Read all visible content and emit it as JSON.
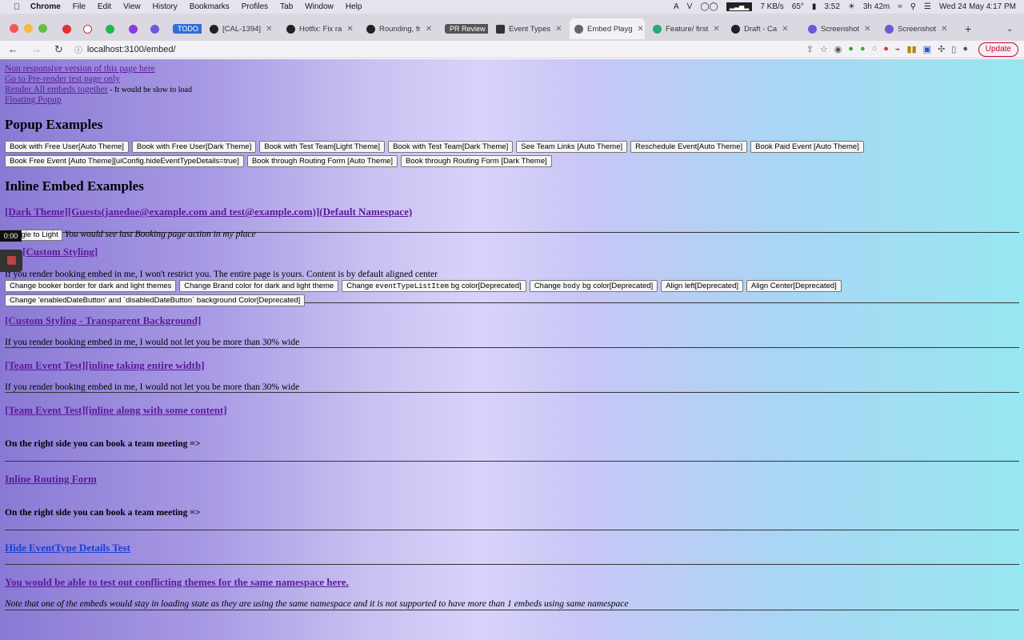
{
  "menubar": {
    "app": "Chrome",
    "menus": [
      "File",
      "Edit",
      "View",
      "History",
      "Bookmarks",
      "Profiles",
      "Tab",
      "Window",
      "Help"
    ],
    "net": "7 KB/s",
    "temp": "65°",
    "time_short": "3:52",
    "battery_time": "3h 42m",
    "datetime": "Wed 24 May  4:17 PM"
  },
  "tabs": [
    {
      "label": "TODO",
      "kind": "pill"
    },
    {
      "label": "[CAL-1394]"
    },
    {
      "label": "Hotfix: Fix ra"
    },
    {
      "label": "Rounding, fr"
    },
    {
      "label": "PR Review",
      "kind": "pill-dark"
    },
    {
      "label": "Event Types"
    },
    {
      "label": "Embed Playg",
      "active": true
    },
    {
      "label": "Feature/ first"
    },
    {
      "label": "Draft - Ca"
    },
    {
      "label": "Screenshot"
    },
    {
      "label": "Screenshot"
    }
  ],
  "address": {
    "url": "localhost:3100/embed/",
    "update_label": "Update"
  },
  "links": {
    "non_responsive": "Non responsive version of this page here",
    "prerender": "Go to Pre-render test page only",
    "render_all": "Render All embeds together",
    "render_all_note": " - It would be slow to load",
    "floating": "Floating Popup"
  },
  "popup": {
    "heading": "Popup Examples",
    "buttons": [
      "Book with Free User[Auto Theme]",
      "Book with Free User[Dark Theme]",
      "Book with Test Team[Light Theme]",
      "Book with Test Team[Dark Theme]",
      "See Team Links [Auto Theme]",
      "Reschedule Event[Auto Theme]",
      "Book Paid Event [Auto Theme]",
      "Book Free Event [Auto Theme][uiConfig.hideEventTypeDetails=true]",
      "Book through Routing Form [Auto Theme]",
      "Book through Routing Form [Dark Theme]"
    ]
  },
  "inline": {
    "heading": "Inline Embed Examples",
    "s1_title": "[Dark Theme][Guests(janedoe@example.com and test@example.com)](Default Namespace)",
    "s1_toggle": "Toggle to Light",
    "s1_note": "You would see last Booking page action in my place",
    "timer": "0:00",
    "s2_title": "[Custom Styling]",
    "s2_text": "If you render booking embed in me, I won't restrict you. The entire page is yours. Content is by default aligned center",
    "s2_btn_border": "Change booker border for dark and light themes",
    "s2_btn_brand": "Change Brand color for dark and light theme",
    "s2_btn_change": "Change",
    "s2_btn_code": "eventTypeListItem",
    "s2_btn_bg": "bg color[Deprecated]",
    "s2_btn_body_a": "Change",
    "s2_btn_body_code": "body",
    "s2_btn_body_b": "bg color[Deprecated]",
    "s2_btn_left": "Align left[Deprecated]",
    "s2_btn_center": "Align Center[Deprecated]",
    "s2_btn_date": "Change 'enabledDateButton' and `disabledDateButton` background Color[Deprecated]",
    "s3_title": "[Custom Styling - Transparent Background]",
    "s3_text": "If you render booking embed in me, I would not let you be more than 30% wide",
    "s4_title": "[Team Event Test][inline taking entire width]",
    "s4_text": "If you render booking embed in me, I would not let you be more than 30% wide",
    "s5_title": "[Team Event Test][inline along with some content]",
    "s5_text": "On the right side you can book a team meeting =>",
    "s6_title": "Inline Routing Form",
    "s6_text": "On the right side you can book a team meeting =>",
    "s7_title": "Hide EventType Details Test",
    "s8_title": "You would be able to test out conflicting themes for the same namespace here.",
    "s8_note": "Note that one of the embeds would stay in loading state as they are using the same namespace and it is not supported to have more than 1 embeds using same namespace"
  }
}
